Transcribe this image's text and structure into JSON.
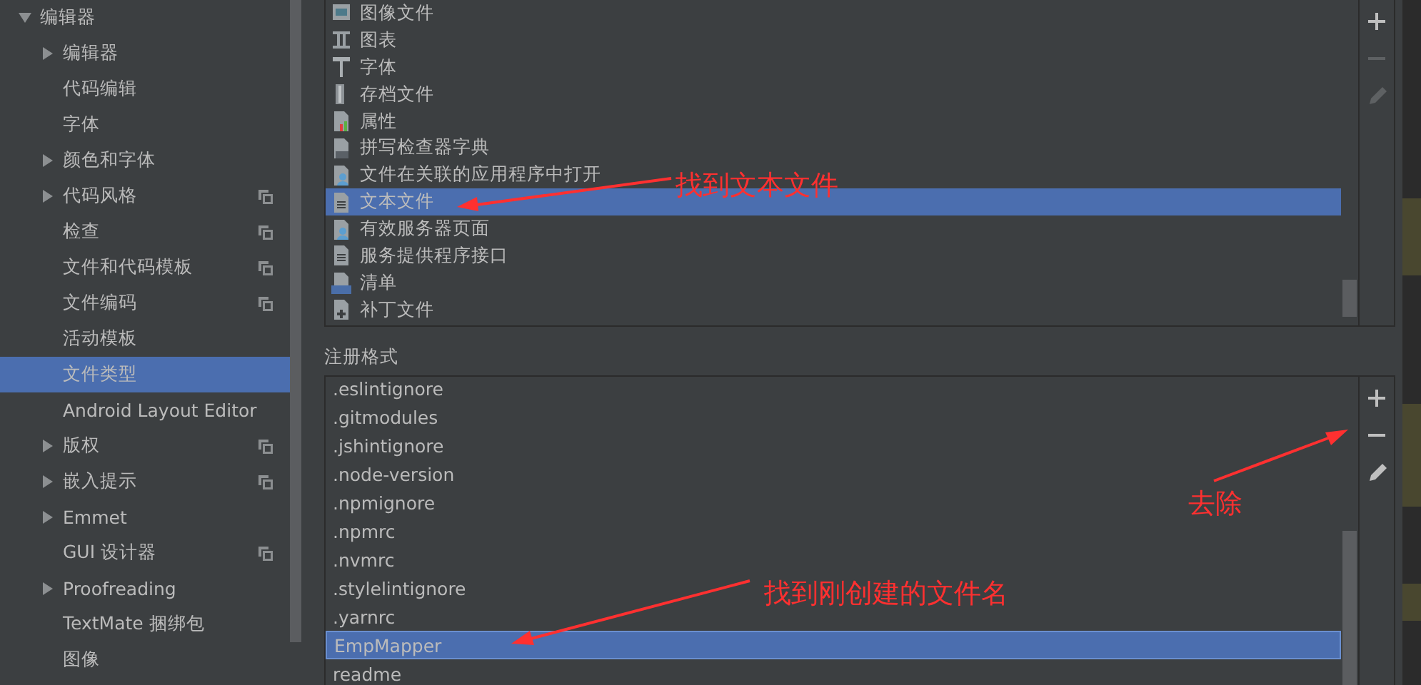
{
  "sidebar": {
    "items": [
      {
        "label": "编辑器",
        "kind": "group",
        "expanded": true,
        "selected": false,
        "shared": false,
        "children": [
          {
            "label": "编辑器",
            "kind": "group",
            "expanded": false,
            "selected": false,
            "shared": false
          },
          {
            "label": "代码编辑",
            "kind": "page",
            "selected": false,
            "shared": false
          },
          {
            "label": "字体",
            "kind": "page",
            "selected": false,
            "shared": false
          },
          {
            "label": "颜色和字体",
            "kind": "group",
            "expanded": false,
            "selected": false,
            "shared": false
          },
          {
            "label": "代码风格",
            "kind": "group",
            "expanded": false,
            "selected": false,
            "shared": true
          },
          {
            "label": "检查",
            "kind": "page",
            "selected": false,
            "shared": true
          },
          {
            "label": "文件和代码模板",
            "kind": "page",
            "selected": false,
            "shared": true
          },
          {
            "label": "文件编码",
            "kind": "page",
            "selected": false,
            "shared": true
          },
          {
            "label": "活动模板",
            "kind": "page",
            "selected": false,
            "shared": false
          },
          {
            "label": "文件类型",
            "kind": "page",
            "selected": true,
            "shared": false
          },
          {
            "label": "Android Layout Editor",
            "kind": "page",
            "selected": false,
            "shared": false
          },
          {
            "label": "版权",
            "kind": "group",
            "expanded": false,
            "selected": false,
            "shared": true
          },
          {
            "label": "嵌入提示",
            "kind": "group",
            "expanded": false,
            "selected": false,
            "shared": true
          },
          {
            "label": "Emmet",
            "kind": "group",
            "expanded": false,
            "selected": false,
            "shared": false
          },
          {
            "label": "GUI 设计器",
            "kind": "page",
            "selected": false,
            "shared": true
          },
          {
            "label": "Proofreading",
            "kind": "group",
            "expanded": false,
            "selected": false,
            "shared": false
          },
          {
            "label": "TextMate 捆绑包",
            "kind": "page",
            "selected": false,
            "shared": false
          },
          {
            "label": "图像",
            "kind": "page",
            "selected": false,
            "shared": false
          }
        ]
      }
    ]
  },
  "file_types": {
    "items": [
      {
        "label": "图像文件",
        "kind": "image",
        "selected": false
      },
      {
        "label": "图表",
        "kind": "diagram",
        "selected": false
      },
      {
        "label": "字体",
        "kind": "font",
        "selected": false
      },
      {
        "label": "存档文件",
        "kind": "archive",
        "selected": false
      },
      {
        "label": "属性",
        "kind": "properties",
        "selected": false
      },
      {
        "label": "拼写检查器字典",
        "kind": "dictionary",
        "selected": false
      },
      {
        "label": "文件在关联的应用程序中打开",
        "kind": "native",
        "selected": false
      },
      {
        "label": "文本文件",
        "kind": "text",
        "selected": true
      },
      {
        "label": "有效服务器页面",
        "kind": "native",
        "selected": false
      },
      {
        "label": "服务提供程序接口",
        "kind": "text",
        "selected": false
      },
      {
        "label": "清单",
        "kind": "manifest",
        "selected": false
      },
      {
        "label": "补丁文件",
        "kind": "patch",
        "selected": false
      }
    ],
    "toolbar": [
      {
        "kind": "add",
        "disabled": false
      },
      {
        "kind": "remove",
        "disabled": true
      },
      {
        "kind": "edit",
        "disabled": true
      }
    ]
  },
  "registered_patterns": {
    "title": "注册格式",
    "items": [
      {
        "label": ".eslintignore",
        "selected": false
      },
      {
        "label": ".gitmodules",
        "selected": false
      },
      {
        "label": ".jshintignore",
        "selected": false
      },
      {
        "label": ".node-version",
        "selected": false
      },
      {
        "label": ".npmignore",
        "selected": false
      },
      {
        "label": ".npmrc",
        "selected": false
      },
      {
        "label": ".nvmrc",
        "selected": false
      },
      {
        "label": ".stylelintignore",
        "selected": false
      },
      {
        "label": ".yarnrc",
        "selected": false
      },
      {
        "label": "EmpMapper",
        "selected": true
      },
      {
        "label": "readme",
        "selected": false
      }
    ],
    "toolbar": [
      {
        "kind": "add",
        "disabled": false
      },
      {
        "kind": "remove",
        "disabled": false
      },
      {
        "kind": "edit",
        "disabled": false
      }
    ]
  },
  "annotations": [
    {
      "text": "找到文本文件"
    },
    {
      "text": "找到刚创建的文件名"
    },
    {
      "text": "去除"
    }
  ]
}
